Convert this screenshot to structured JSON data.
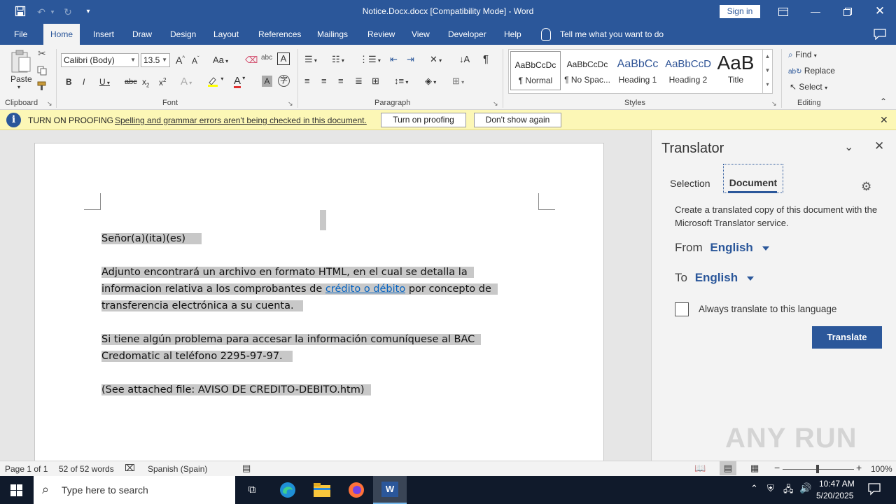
{
  "titlebar": {
    "title": "Notice.Docx.docx [Compatibility Mode] - Word",
    "sign_in": "Sign in"
  },
  "tabs": [
    {
      "label": "File"
    },
    {
      "label": "Home"
    },
    {
      "label": "Insert"
    },
    {
      "label": "Draw"
    },
    {
      "label": "Design"
    },
    {
      "label": "Layout"
    },
    {
      "label": "References"
    },
    {
      "label": "Mailings"
    },
    {
      "label": "Review"
    },
    {
      "label": "View"
    },
    {
      "label": "Developer"
    },
    {
      "label": "Help"
    }
  ],
  "tell_me": "Tell me what you want to do",
  "ribbon": {
    "clipboard_label": "Clipboard",
    "paste_label": "Paste",
    "font_label": "Font",
    "font_name": "Calibri (Body)",
    "font_size": "13.5",
    "paragraph_label": "Paragraph",
    "styles_label": "Styles",
    "editing_label": "Editing",
    "styles": [
      {
        "preview": "AaBbCcDc",
        "name": "¶ Normal"
      },
      {
        "preview": "AaBbCcDc",
        "name": "¶ No Spac..."
      },
      {
        "preview": "AaBbCc",
        "name": "Heading 1"
      },
      {
        "preview": "AaBbCcD",
        "name": "Heading 2"
      },
      {
        "preview": "AaB",
        "name": "Title"
      }
    ],
    "find_label": "Find",
    "replace_label": "Replace",
    "select_label": "Select"
  },
  "notification": {
    "title": "TURN ON PROOFING",
    "message": "Spelling and grammar errors aren't being checked in this document.",
    "turn_on_label": "Turn on proofing",
    "dont_show_label": "Don't show again"
  },
  "document": {
    "greeting": "Señor(a)(ita)(es)",
    "para1_a": "Adjunto  encontrará un archivo en formato HTML, en el cual se detalla la",
    "para1_b_pre": "informacion relativa a los comprobantes de ",
    "para1_b_link": "crédito o débito",
    "para1_b_post": " por concepto de",
    "para1_c": "transferencia electrónica a su cuenta.",
    "para2_a": "Si tiene algún problema para accesar la información comuníquese al BAC",
    "para2_b": "Credomatic al teléfono 2295-97-97.",
    "attached": "(See attached file: AVISO DE CREDITO-DEBITO.htm)"
  },
  "translator": {
    "title": "Translator",
    "tab_selection": "Selection",
    "tab_document": "Document",
    "description": "Create a translated copy of this document with the Microsoft Translator service.",
    "from_label": "From",
    "from_value": "English",
    "to_label": "To",
    "to_value": "English",
    "always_label": "Always translate to this language",
    "translate_button": "Translate"
  },
  "status": {
    "page": "Page 1 of 1",
    "words": "52 of 52 words",
    "language": "Spanish (Spain)",
    "zoom": "100%"
  },
  "taskbar": {
    "search_placeholder": "Type here to search",
    "time": "10:47 AM",
    "date": "5/20/2025"
  },
  "watermark": "ANY RUN"
}
